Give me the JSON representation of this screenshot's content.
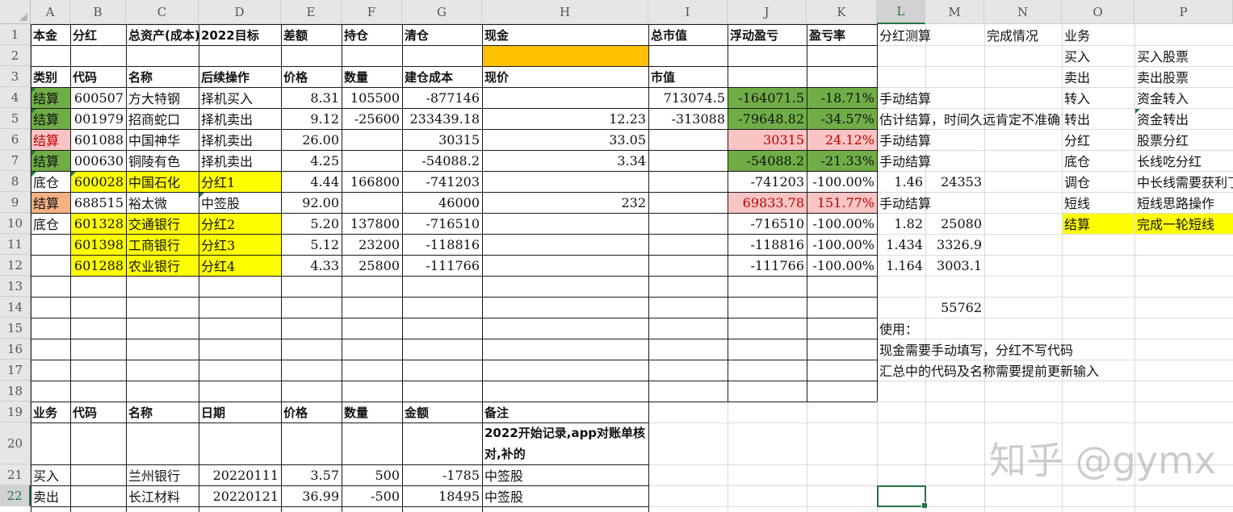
{
  "columns": [
    "A",
    "B",
    "C",
    "D",
    "E",
    "F",
    "G",
    "H",
    "I",
    "J",
    "K",
    "L",
    "M",
    "N",
    "O",
    "P"
  ],
  "rows": [
    1,
    2,
    3,
    4,
    5,
    6,
    7,
    8,
    9,
    10,
    11,
    12,
    13,
    14,
    15,
    16,
    17,
    18,
    19,
    20,
    21,
    22
  ],
  "selected_column": "L",
  "selected_row": 22,
  "watermark": "知乎 @gymx",
  "colors": {
    "green": "#70ad47",
    "orange": "#ffc000",
    "yellow": "#ffff00",
    "pink": "#f8c4c4",
    "salmon": "#f4b183",
    "selection": "#217346"
  },
  "cells": [
    {
      "ref": "A1",
      "text": "本金",
      "bold": true
    },
    {
      "ref": "B1",
      "text": "分红",
      "bold": true
    },
    {
      "ref": "C1",
      "text": "总资产(成本)",
      "bold": true
    },
    {
      "ref": "D1",
      "text": "2022目标",
      "bold": true
    },
    {
      "ref": "E1",
      "text": "差额",
      "bold": true
    },
    {
      "ref": "F1",
      "text": "持仓",
      "bold": true
    },
    {
      "ref": "G1",
      "text": "清仓",
      "bold": true
    },
    {
      "ref": "H1",
      "text": "现金",
      "bold": true
    },
    {
      "ref": "I1",
      "text": "总市值",
      "bold": true
    },
    {
      "ref": "J1",
      "text": "浮动盈亏",
      "bold": true
    },
    {
      "ref": "K1",
      "text": "盈亏率",
      "bold": true
    },
    {
      "ref": "L1",
      "text": "分红测算"
    },
    {
      "ref": "N1",
      "text": "完成情况"
    },
    {
      "ref": "O1",
      "text": "业务"
    },
    {
      "ref": "O2",
      "text": "买入"
    },
    {
      "ref": "P2",
      "text": "买入股票"
    },
    {
      "ref": "A3",
      "text": "类别",
      "bold": true
    },
    {
      "ref": "B3",
      "text": "代码",
      "bold": true
    },
    {
      "ref": "C3",
      "text": "名称",
      "bold": true
    },
    {
      "ref": "D3",
      "text": "后续操作",
      "bold": true
    },
    {
      "ref": "E3",
      "text": "价格",
      "bold": true
    },
    {
      "ref": "F3",
      "text": "数量",
      "bold": true
    },
    {
      "ref": "G3",
      "text": "建仓成本",
      "bold": true
    },
    {
      "ref": "H3",
      "text": "现价",
      "bold": true
    },
    {
      "ref": "I3",
      "text": "市值",
      "bold": true
    },
    {
      "ref": "O3",
      "text": "卖出"
    },
    {
      "ref": "P3",
      "text": "卖出股票"
    },
    {
      "ref": "A4",
      "text": "结算"
    },
    {
      "ref": "B4",
      "text": "600507",
      "right": true
    },
    {
      "ref": "C4",
      "text": "方大特钢"
    },
    {
      "ref": "D4",
      "text": "择机买入"
    },
    {
      "ref": "E4",
      "text": "8.31",
      "right": true
    },
    {
      "ref": "F4",
      "text": "105500",
      "right": true
    },
    {
      "ref": "G4",
      "text": "-877146",
      "right": true
    },
    {
      "ref": "I4",
      "text": "713074.5",
      "right": true
    },
    {
      "ref": "J4",
      "text": "-164071.5",
      "right": true
    },
    {
      "ref": "K4",
      "text": "-18.71%",
      "right": true
    },
    {
      "ref": "L4",
      "text": "手动结算"
    },
    {
      "ref": "O4",
      "text": "转入"
    },
    {
      "ref": "P4",
      "text": "资金转入"
    },
    {
      "ref": "A5",
      "text": "结算"
    },
    {
      "ref": "B5",
      "text": "001979",
      "right": true
    },
    {
      "ref": "C5",
      "text": "招商蛇口"
    },
    {
      "ref": "D5",
      "text": "择机卖出"
    },
    {
      "ref": "E5",
      "text": "9.12",
      "right": true
    },
    {
      "ref": "F5",
      "text": "-25600",
      "right": true
    },
    {
      "ref": "G5",
      "text": "233439.18",
      "right": true
    },
    {
      "ref": "H5",
      "text": "12.23",
      "right": true
    },
    {
      "ref": "I5",
      "text": "-313088",
      "right": true
    },
    {
      "ref": "J5",
      "text": "-79648.82",
      "right": true
    },
    {
      "ref": "K5",
      "text": "-34.57%",
      "right": true
    },
    {
      "ref": "L5",
      "text": "估计结算，时间久远肯定不准确了"
    },
    {
      "ref": "O5",
      "text": "转出"
    },
    {
      "ref": "P5",
      "text": "资金转出"
    },
    {
      "ref": "A6",
      "text": "结算",
      "red": true
    },
    {
      "ref": "B6",
      "text": "601088",
      "right": true
    },
    {
      "ref": "C6",
      "text": "中国神华"
    },
    {
      "ref": "D6",
      "text": "择机卖出"
    },
    {
      "ref": "E6",
      "text": "26.00",
      "right": true
    },
    {
      "ref": "G6",
      "text": "30315",
      "right": true
    },
    {
      "ref": "H6",
      "text": "33.05",
      "right": true
    },
    {
      "ref": "J6",
      "text": "30315",
      "right": true,
      "red": true
    },
    {
      "ref": "K6",
      "text": "24.12%",
      "right": true,
      "red": true
    },
    {
      "ref": "L6",
      "text": "手动结算"
    },
    {
      "ref": "O6",
      "text": "分红"
    },
    {
      "ref": "P6",
      "text": "股票分红"
    },
    {
      "ref": "A7",
      "text": "结算"
    },
    {
      "ref": "B7",
      "text": "000630",
      "right": true
    },
    {
      "ref": "C7",
      "text": "铜陵有色"
    },
    {
      "ref": "D7",
      "text": "择机卖出"
    },
    {
      "ref": "E7",
      "text": "4.25",
      "right": true
    },
    {
      "ref": "G7",
      "text": "-54088.2",
      "right": true
    },
    {
      "ref": "H7",
      "text": "3.34",
      "right": true
    },
    {
      "ref": "J7",
      "text": "-54088.2",
      "right": true
    },
    {
      "ref": "K7",
      "text": "-21.33%",
      "right": true
    },
    {
      "ref": "L7",
      "text": "手动结算"
    },
    {
      "ref": "O7",
      "text": "底仓"
    },
    {
      "ref": "P7",
      "text": "长线吃分红"
    },
    {
      "ref": "A8",
      "text": "底仓"
    },
    {
      "ref": "B8",
      "text": "600028",
      "right": true
    },
    {
      "ref": "C8",
      "text": "中国石化"
    },
    {
      "ref": "D8",
      "text": "分红1"
    },
    {
      "ref": "E8",
      "text": "4.44",
      "right": true
    },
    {
      "ref": "F8",
      "text": "166800",
      "right": true
    },
    {
      "ref": "G8",
      "text": "-741203",
      "right": true
    },
    {
      "ref": "J8",
      "text": "-741203",
      "right": true
    },
    {
      "ref": "K8",
      "text": "-100.00%",
      "right": true
    },
    {
      "ref": "L8",
      "text": "1.46",
      "right": true
    },
    {
      "ref": "M8",
      "text": "24353",
      "right": true
    },
    {
      "ref": "O8",
      "text": "调仓"
    },
    {
      "ref": "P8",
      "text": "中长线需要获利了结"
    },
    {
      "ref": "A9",
      "text": "结算"
    },
    {
      "ref": "B9",
      "text": "688515",
      "right": true
    },
    {
      "ref": "C9",
      "text": "裕太微"
    },
    {
      "ref": "D9",
      "text": "中签股"
    },
    {
      "ref": "E9",
      "text": "92.00",
      "right": true
    },
    {
      "ref": "G9",
      "text": "46000",
      "right": true
    },
    {
      "ref": "H9",
      "text": "232",
      "right": true
    },
    {
      "ref": "J9",
      "text": "69833.78",
      "right": true,
      "red": true
    },
    {
      "ref": "K9",
      "text": "151.77%",
      "right": true,
      "red": true
    },
    {
      "ref": "L9",
      "text": "手动结算"
    },
    {
      "ref": "O9",
      "text": "短线"
    },
    {
      "ref": "P9",
      "text": "短线思路操作"
    },
    {
      "ref": "A10",
      "text": "底仓"
    },
    {
      "ref": "B10",
      "text": "601328",
      "right": true
    },
    {
      "ref": "C10",
      "text": "交通银行"
    },
    {
      "ref": "D10",
      "text": "分红2"
    },
    {
      "ref": "E10",
      "text": "5.20",
      "right": true
    },
    {
      "ref": "F10",
      "text": "137800",
      "right": true
    },
    {
      "ref": "G10",
      "text": "-716510",
      "right": true
    },
    {
      "ref": "J10",
      "text": "-716510",
      "right": true
    },
    {
      "ref": "K10",
      "text": "-100.00%",
      "right": true
    },
    {
      "ref": "L10",
      "text": "1.82",
      "right": true
    },
    {
      "ref": "M10",
      "text": "25080",
      "right": true
    },
    {
      "ref": "O10",
      "text": "结算"
    },
    {
      "ref": "P10",
      "text": "完成一轮短线"
    },
    {
      "ref": "B11",
      "text": "601398",
      "right": true
    },
    {
      "ref": "C11",
      "text": "工商银行"
    },
    {
      "ref": "D11",
      "text": "分红3"
    },
    {
      "ref": "E11",
      "text": "5.12",
      "right": true
    },
    {
      "ref": "F11",
      "text": "23200",
      "right": true
    },
    {
      "ref": "G11",
      "text": "-118816",
      "right": true
    },
    {
      "ref": "J11",
      "text": "-118816",
      "right": true
    },
    {
      "ref": "K11",
      "text": "-100.00%",
      "right": true
    },
    {
      "ref": "L11",
      "text": "1.434",
      "right": true
    },
    {
      "ref": "M11",
      "text": "3326.9",
      "right": true
    },
    {
      "ref": "B12",
      "text": "601288",
      "right": true
    },
    {
      "ref": "C12",
      "text": "农业银行"
    },
    {
      "ref": "D12",
      "text": "分红4"
    },
    {
      "ref": "E12",
      "text": "4.33",
      "right": true
    },
    {
      "ref": "F12",
      "text": "25800",
      "right": true
    },
    {
      "ref": "G12",
      "text": "-111766",
      "right": true
    },
    {
      "ref": "J12",
      "text": "-111766",
      "right": true
    },
    {
      "ref": "K12",
      "text": "-100.00%",
      "right": true
    },
    {
      "ref": "L12",
      "text": "1.164",
      "right": true
    },
    {
      "ref": "M12",
      "text": "3003.1",
      "right": true
    },
    {
      "ref": "M14",
      "text": "55762",
      "right": true
    },
    {
      "ref": "L15",
      "text": "使用："
    },
    {
      "ref": "L16",
      "text": "现金需要手动填写，分红不写代码"
    },
    {
      "ref": "L17",
      "text": "汇总中的代码及名称需要提前更新输入"
    },
    {
      "ref": "A19",
      "text": "业务",
      "bold": true
    },
    {
      "ref": "B19",
      "text": "代码",
      "bold": true
    },
    {
      "ref": "C19",
      "text": "名称",
      "bold": true
    },
    {
      "ref": "D19",
      "text": "日期",
      "bold": true
    },
    {
      "ref": "E19",
      "text": "价格",
      "bold": true
    },
    {
      "ref": "F19",
      "text": "数量",
      "bold": true
    },
    {
      "ref": "G19",
      "text": "金额",
      "bold": true
    },
    {
      "ref": "H19",
      "text": "备注",
      "bold": true
    },
    {
      "ref": "H20",
      "text": "2022开始记录,app对账单核对,补的",
      "bold": true,
      "wrap": true
    },
    {
      "ref": "A21",
      "text": "买入"
    },
    {
      "ref": "C21",
      "text": "兰州银行"
    },
    {
      "ref": "D21",
      "text": "20220111",
      "right": true
    },
    {
      "ref": "E21",
      "text": "3.57",
      "right": true
    },
    {
      "ref": "F21",
      "text": "500",
      "right": true
    },
    {
      "ref": "G21",
      "text": "-1785",
      "right": true
    },
    {
      "ref": "H21",
      "text": "中签股"
    },
    {
      "ref": "A22",
      "text": "卖出"
    },
    {
      "ref": "C22",
      "text": "长江材料"
    },
    {
      "ref": "D22",
      "text": "20220121",
      "right": true
    },
    {
      "ref": "E22",
      "text": "36.99",
      "right": true
    },
    {
      "ref": "F22",
      "text": "-500",
      "right": true
    },
    {
      "ref": "G22",
      "text": "18495",
      "right": true
    },
    {
      "ref": "H22",
      "text": "中签股"
    }
  ],
  "fills": [
    {
      "range": "H2",
      "color": "orange"
    },
    {
      "range": "A4",
      "color": "green"
    },
    {
      "range": "A5",
      "color": "green"
    },
    {
      "range": "A6",
      "color": "pink"
    },
    {
      "range": "A7",
      "color": "green"
    },
    {
      "range": "A9",
      "color": "salmon"
    },
    {
      "range": "J4:K5",
      "color": "green"
    },
    {
      "range": "J6:K6",
      "color": "pink"
    },
    {
      "range": "J7:K7",
      "color": "green"
    },
    {
      "range": "J9:K9",
      "color": "pink"
    },
    {
      "range": "B8:D8",
      "color": "yellow"
    },
    {
      "range": "B10:D12",
      "color": "yellow"
    },
    {
      "range": "O10:P10",
      "color": "yellow"
    }
  ]
}
